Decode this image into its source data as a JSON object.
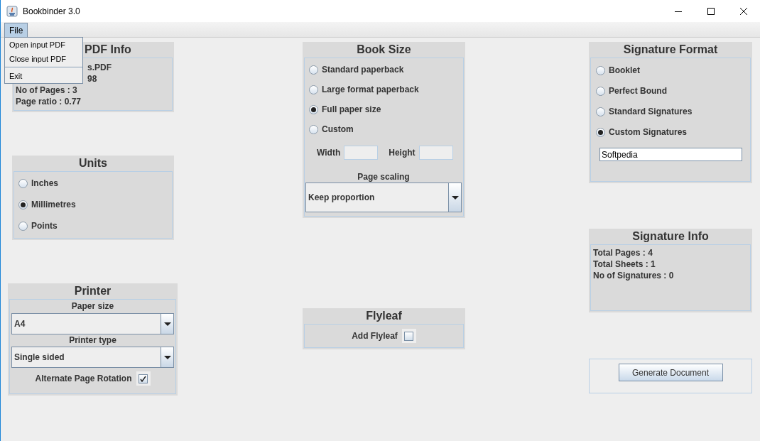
{
  "window": {
    "title": "Bookbinder 3.0"
  },
  "menu_bar": [
    {
      "label": "File",
      "expanded": true,
      "items": [
        {
          "kind": "item",
          "label": "Open input PDF"
        },
        {
          "kind": "item",
          "label": "Close input PDF"
        },
        {
          "kind": "separator"
        },
        {
          "kind": "item",
          "label": "Exit"
        }
      ]
    }
  ],
  "pdf_info": {
    "title": "PDF Info",
    "lines": [
      "s.PDF",
      "98",
      "No of Pages : 3",
      "Page ratio : 0.77"
    ]
  },
  "units": {
    "title": "Units",
    "options": [
      {
        "label": "Inches",
        "selected": false
      },
      {
        "label": "Millimetres",
        "selected": true
      },
      {
        "label": "Points",
        "selected": false
      }
    ]
  },
  "printer": {
    "title": "Printer",
    "paper_size": {
      "label": "Paper size",
      "value": "A4"
    },
    "printer_type": {
      "label": "Printer type",
      "value": "Single sided"
    },
    "alternate_rotation": {
      "label": "Alternate Page Rotation",
      "checked": true
    }
  },
  "book_size": {
    "title": "Book Size",
    "options": [
      {
        "label": "Standard paperback",
        "selected": false
      },
      {
        "label": "Large format paperback",
        "selected": false
      },
      {
        "label": "Full paper size",
        "selected": true
      },
      {
        "label": "Custom",
        "selected": false
      }
    ],
    "width_label": "Width",
    "height_label": "Height",
    "page_scaling": {
      "label": "Page scaling",
      "value": "Keep proportion"
    }
  },
  "flyleaf": {
    "title": "Flyleaf",
    "add_flyleaf": {
      "label": "Add Flyleaf",
      "checked": false
    }
  },
  "signature_format": {
    "title": "Signature Format",
    "options": [
      {
        "label": "Booklet",
        "selected": false
      },
      {
        "label": "Perfect Bound",
        "selected": false
      },
      {
        "label": "Standard Signatures",
        "selected": false
      },
      {
        "label": "Custom Signatures",
        "selected": true
      }
    ],
    "custom_value": "Softpedia"
  },
  "signature_info": {
    "title": "Signature Info",
    "lines": [
      "Total Pages : 4",
      "Total Sheets : 1",
      "No of Signatures : 0"
    ]
  },
  "generate_button": "Generate Document"
}
